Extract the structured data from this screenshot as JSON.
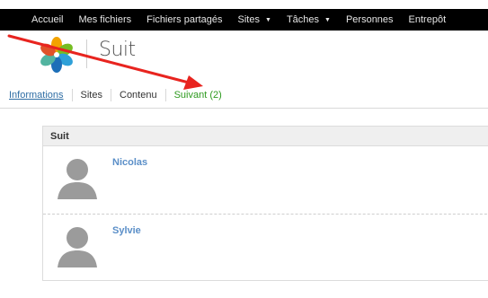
{
  "topnav": {
    "items": [
      {
        "label": "Accueil",
        "dropdown": false
      },
      {
        "label": "Mes fichiers",
        "dropdown": false
      },
      {
        "label": "Fichiers partagés",
        "dropdown": false
      },
      {
        "label": "Sites",
        "dropdown": true
      },
      {
        "label": "Tâches",
        "dropdown": true
      },
      {
        "label": "Personnes",
        "dropdown": false
      },
      {
        "label": "Entrepôt",
        "dropdown": false
      }
    ],
    "caret": "▼"
  },
  "header": {
    "title": "Suit"
  },
  "subnav": {
    "items": [
      {
        "label": "Informations"
      },
      {
        "label": "Sites"
      },
      {
        "label": "Contenu"
      },
      {
        "label": "Suivant (2)"
      }
    ]
  },
  "panel": {
    "title": "Suit",
    "people": [
      {
        "name": "Nicolas"
      },
      {
        "name": "Sylvie"
      }
    ]
  },
  "colors": {
    "topbar": "#000000",
    "link_blue": "#2e6da4",
    "active_green": "#2e9a1f",
    "person_name": "#5b8fc8",
    "arrow_red": "#e8241f"
  },
  "icons": {
    "logo": "alfresco-flower-logo",
    "avatar": "default-user-avatar-icon"
  }
}
